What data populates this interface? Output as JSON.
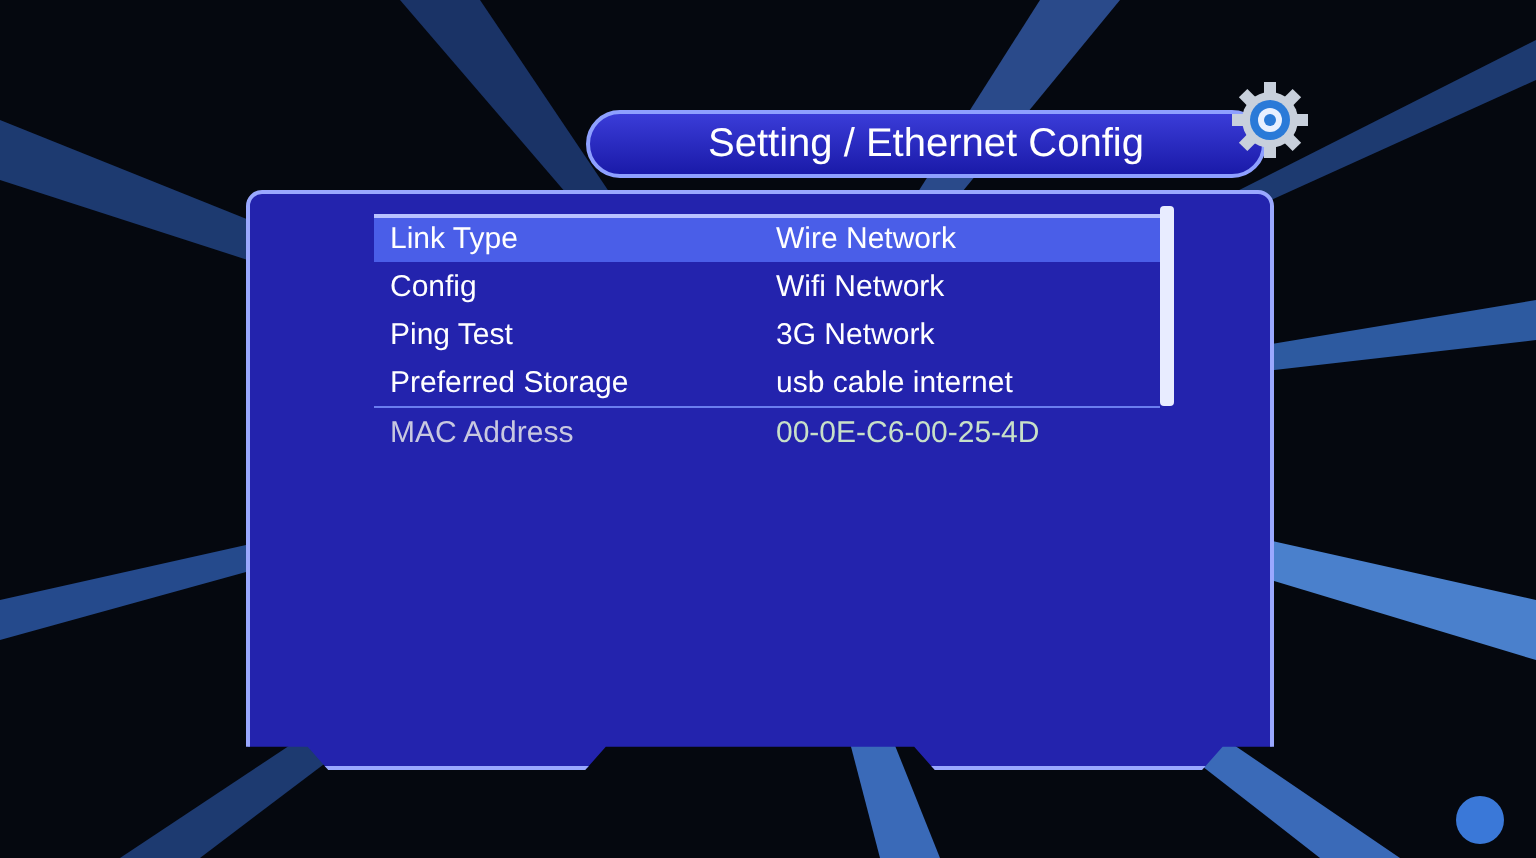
{
  "header": {
    "title": "Setting / Ethernet Config"
  },
  "rows": [
    {
      "label": "Link Type",
      "value": "Wire Network",
      "selected": true,
      "disabled": false
    },
    {
      "label": "Config",
      "value": "Wifi Network",
      "selected": false,
      "disabled": false
    },
    {
      "label": "Ping Test",
      "value": "3G Network",
      "selected": false,
      "disabled": false
    },
    {
      "label": "Preferred Storage",
      "value": "usb cable internet",
      "selected": false,
      "disabled": false
    },
    {
      "label": "MAC Address",
      "value": "00-0E-C6-00-25-4D",
      "selected": false,
      "disabled": true
    }
  ]
}
